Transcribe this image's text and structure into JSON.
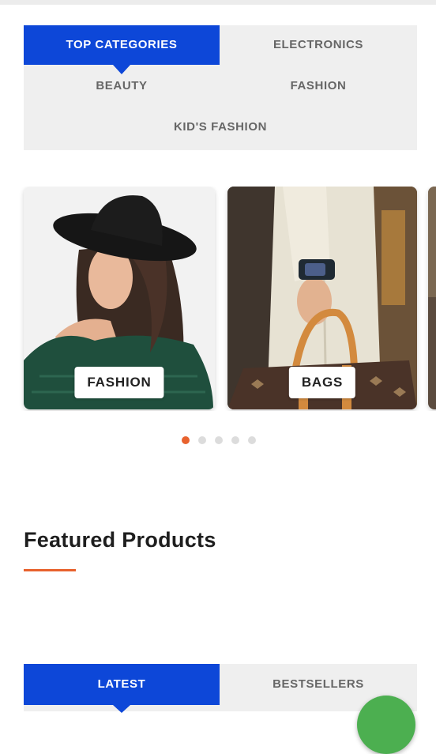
{
  "category_tabs": [
    {
      "label": "TOP CATEGORIES",
      "active": true
    },
    {
      "label": "ELECTRONICS",
      "active": false
    },
    {
      "label": "BEAUTY",
      "active": false
    },
    {
      "label": "FASHION",
      "active": false
    },
    {
      "label": "KID'S FASHION",
      "active": false
    }
  ],
  "carousel": {
    "cards": [
      {
        "label": "FASHION",
        "image": "woman-in-black-hat-photo"
      },
      {
        "label": "BAGS",
        "image": "handbag-and-wristwatch-photo"
      }
    ],
    "dots_total": 5,
    "active_dot": 1
  },
  "featured": {
    "title": "Featured Products"
  },
  "product_tabs": [
    {
      "label": "LATEST",
      "active": true
    },
    {
      "label": "BESTSELLERS",
      "active": false
    }
  ],
  "colors": {
    "accent_blue": "#0d47d8",
    "accent_orange": "#e8622e",
    "fab_green": "#4caf50"
  },
  "icons": {
    "fab": "chat-fab-icon"
  }
}
